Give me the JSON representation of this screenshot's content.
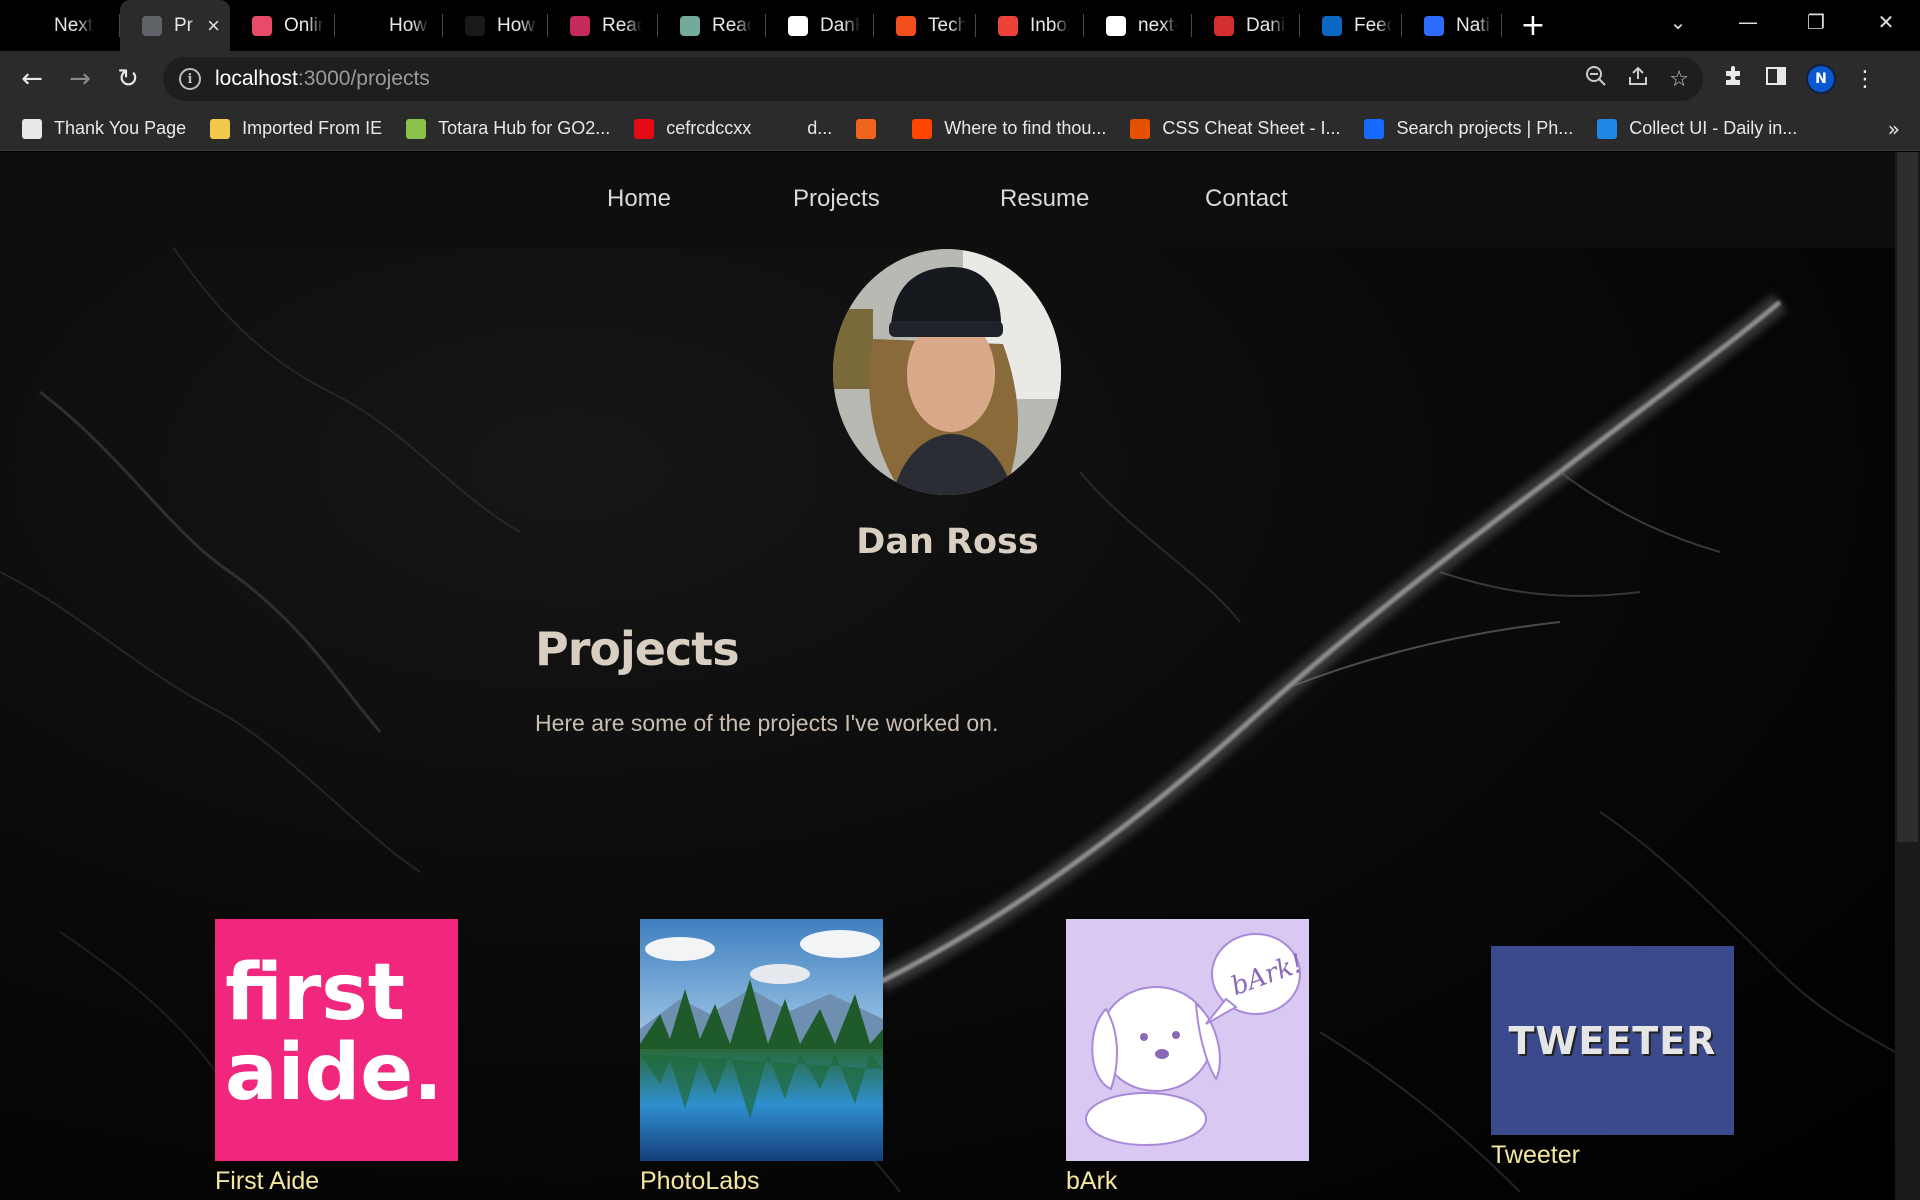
{
  "browser": {
    "tabs": [
      {
        "title": "Next.j",
        "icon": "notion-icon",
        "color": "#000000",
        "active": false
      },
      {
        "title": "Pr",
        "icon": "globe-icon",
        "color": "#5f6368",
        "active": true
      },
      {
        "title": "Onlin",
        "icon": "cloud-icon",
        "color": "#e84a67",
        "active": false
      },
      {
        "title": "How t",
        "icon": "dev-icon",
        "color": "#000000",
        "active": false
      },
      {
        "title": "How t",
        "icon": "code-icon",
        "color": "#1a1a1a",
        "active": false
      },
      {
        "title": "React",
        "icon": "react-icon",
        "color": "#c42b5a",
        "active": false
      },
      {
        "title": "React",
        "icon": "openai-icon",
        "color": "#74aa9c",
        "active": false
      },
      {
        "title": "DanR",
        "icon": "github-icon",
        "color": "#ffffff",
        "active": false
      },
      {
        "title": "Tech",
        "icon": "figma-icon",
        "color": "#f24e1e",
        "active": false
      },
      {
        "title": "Inbox",
        "icon": "gmail-icon",
        "color": "#ea4335",
        "active": false
      },
      {
        "title": "next-j",
        "icon": "vercel-icon",
        "color": "#ffffff",
        "active": false
      },
      {
        "title": "Danie",
        "icon": "pdf-icon",
        "color": "#d32f2f",
        "active": false
      },
      {
        "title": "Feed",
        "icon": "linkedin-icon",
        "color": "#0a66c2",
        "active": false
      },
      {
        "title": "Natio",
        "icon": "spinner-icon",
        "color": "#2d6bff",
        "active": false
      }
    ],
    "address": {
      "host": "localhost",
      "path": ":3000/projects"
    },
    "bookmarks": [
      {
        "label": "Thank You Page",
        "icon": "globe-icon",
        "color": "#e8e8e8"
      },
      {
        "label": "Imported From IE",
        "icon": "folder-icon",
        "color": "#f2c94c"
      },
      {
        "label": "Totara Hub for GO2...",
        "icon": "totara-icon",
        "color": "#8bc34a"
      },
      {
        "label": "cefrcdccxx",
        "icon": "netflix-icon",
        "color": "#e50914"
      },
      {
        "label": "d...",
        "icon": "blank-icon",
        "color": "#2b2b2b"
      },
      {
        "label": "",
        "icon": "etsy-icon",
        "color": "#f1641e"
      },
      {
        "label": "Where to find thou...",
        "icon": "reddit-icon",
        "color": "#ff4500"
      },
      {
        "label": "CSS Cheat Sheet - I...",
        "icon": "css-icon",
        "color": "#e65100"
      },
      {
        "label": "Search projects | Ph...",
        "icon": "behance-icon",
        "color": "#1769ff"
      },
      {
        "label": "Collect UI - Daily in...",
        "icon": "collectui-icon",
        "color": "#1e88e5"
      }
    ],
    "bookmarks_more": "»"
  },
  "site": {
    "nav": [
      "Home",
      "Projects",
      "Resume",
      "Contact"
    ],
    "name": "Dan Ross",
    "heading": "Projects",
    "intro": "Here are some of the projects I've worked on.",
    "projects": [
      {
        "title": "First Aide",
        "logo_lines": [
          "first",
          "aide."
        ],
        "bg": "#f0277d"
      },
      {
        "title": "PhotoLabs",
        "logo_lines": [],
        "bg": "#3f7fc0"
      },
      {
        "title": "bArk",
        "logo_lines": [
          "bArk!"
        ],
        "bg": "#d9c9f2"
      },
      {
        "title": "Tweeter",
        "logo_lines": [
          "TWEETER"
        ],
        "bg": "#3a4a8c"
      }
    ]
  }
}
